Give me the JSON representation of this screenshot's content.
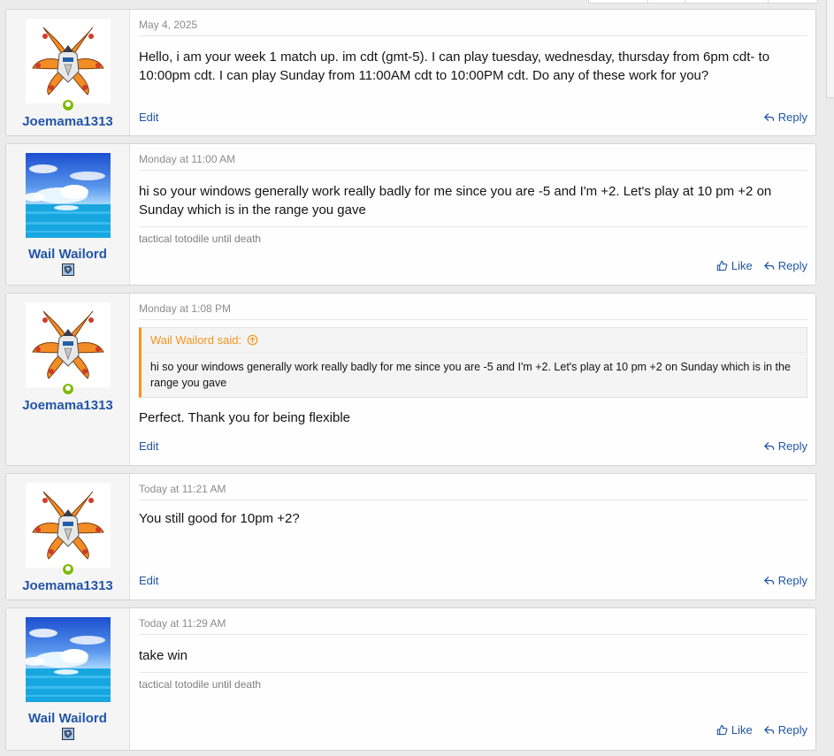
{
  "posts": [
    {
      "username": "Joemama1313",
      "online": true,
      "date": "May 4, 2025",
      "body": "Hello, i am your week 1 match up. im cdt (gmt-5). I can play tuesday, wednesday, thursday from 6pm cdt- to 10:00pm cdt. I can play Sunday from 11:00AM cdt to 10:00PM cdt. Do any of these work for you?",
      "edit_label": "Edit",
      "reply_label": "Reply"
    },
    {
      "username": "Wail Wailord",
      "online": false,
      "date": "Monday at 11:00 AM",
      "body": "hi so your windows generally work really badly for me since you are -5 and I'm +2. Let's play at 10 pm +2 on Sunday which is in the range you gave",
      "signature": "tactical totodile until death",
      "like_label": "Like",
      "reply_label": "Reply"
    },
    {
      "username": "Joemama1313",
      "online": true,
      "date": "Monday at 1:08 PM",
      "quote_author": "Wail Wailord said:",
      "quote_body": "hi so your windows generally work really badly for me since you are -5 and I'm +2. Let's play at 10 pm +2 on Sunday which is in the range you gave",
      "body": "Perfect. Thank you for being flexible",
      "edit_label": "Edit",
      "reply_label": "Reply"
    },
    {
      "username": "Joemama1313",
      "online": true,
      "date": "Today at 11:21 AM",
      "body": "You still good for 10pm +2?",
      "edit_label": "Edit",
      "reply_label": "Reply"
    },
    {
      "username": "Wail Wailord",
      "online": false,
      "date": "Today at 11:29 AM",
      "body": "take win",
      "signature": "tactical totodile until death",
      "like_label": "Like",
      "reply_label": "Reply"
    }
  ],
  "colors": {
    "link": "#2155a6",
    "online": "#7fb900",
    "quote_accent": "#f7941d"
  },
  "icons": [
    "online-status-icon",
    "reply-icon",
    "like-icon",
    "quote-jump-icon",
    "trophy-badge-icon"
  ]
}
